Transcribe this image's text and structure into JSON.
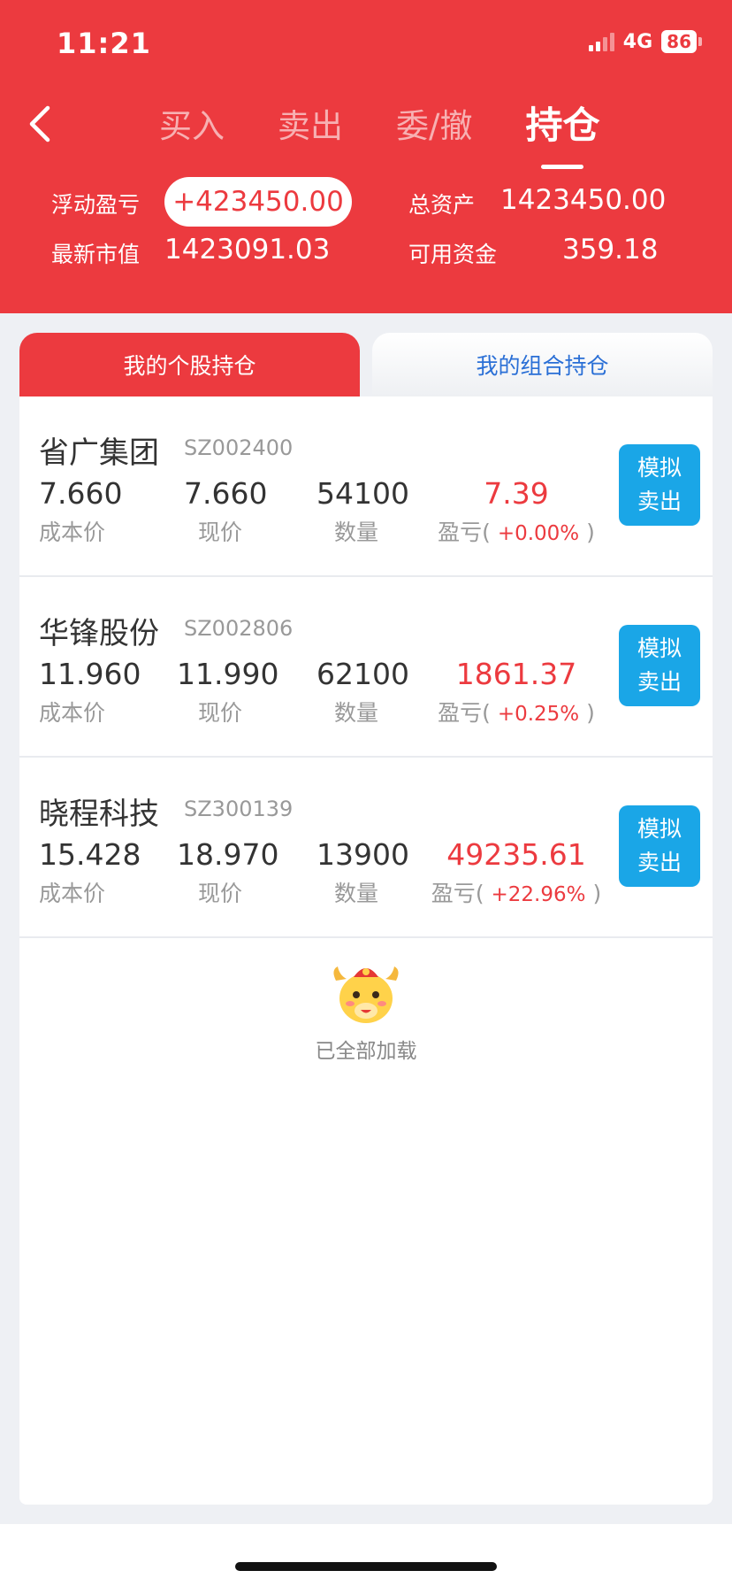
{
  "status_bar": {
    "time": "11:21",
    "network": "4G",
    "battery": "86"
  },
  "nav": {
    "tabs": [
      {
        "label": "买入",
        "active": false
      },
      {
        "label": "卖出",
        "active": false
      },
      {
        "label": "委/撤",
        "active": false
      },
      {
        "label": "持仓",
        "active": true
      }
    ]
  },
  "summary": {
    "floating_pnl_label": "浮动盈亏",
    "floating_pnl_value": "+423450.00",
    "total_assets_label": "总资产",
    "total_assets_value": "1423450.00",
    "market_value_label": "最新市值",
    "market_value_value": "1423091.03",
    "available_funds_label": "可用资金",
    "available_funds_value": "359.18"
  },
  "segments": {
    "left": "我的个股持仓",
    "right": "我的组合持仓",
    "active": "left"
  },
  "labels": {
    "cost": "成本价",
    "price": "现价",
    "qty": "数量",
    "pnl": "盈亏",
    "sell_line1": "模拟",
    "sell_line2": "卖出"
  },
  "holdings": [
    {
      "name": "省广集团",
      "code": "SZ002400",
      "cost": "7.660",
      "price": "7.660",
      "qty": "54100",
      "pnl": "7.39",
      "pct": "+0.00%"
    },
    {
      "name": "华锋股份",
      "code": "SZ002806",
      "cost": "11.960",
      "price": "11.990",
      "qty": "62100",
      "pnl": "1861.37",
      "pct": "+0.25%"
    },
    {
      "name": "晓程科技",
      "code": "SZ300139",
      "cost": "15.428",
      "price": "18.970",
      "qty": "13900",
      "pnl": "49235.61",
      "pct": "+22.96%"
    }
  ],
  "footer": {
    "loaded_text": "已全部加载"
  },
  "colors": {
    "brand_red": "#ec3a3f",
    "sell_blue": "#1aa6e7",
    "link_blue": "#2a6fd6"
  }
}
